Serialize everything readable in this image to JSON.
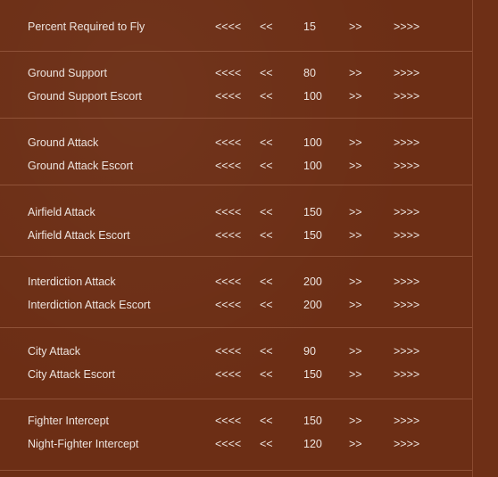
{
  "controls": {
    "dec_large": "<<<<",
    "dec_small": "<<",
    "inc_small": ">>",
    "inc_large": ">>>>"
  },
  "rows": [
    {
      "label": "Percent Required to Fly",
      "value": "15"
    },
    {
      "label": "Ground Support",
      "value": "80"
    },
    {
      "label": "Ground Support Escort",
      "value": "100"
    },
    {
      "label": "Ground Attack",
      "value": "100"
    },
    {
      "label": "Ground Attack Escort",
      "value": "100"
    },
    {
      "label": "Airfield Attack",
      "value": "150"
    },
    {
      "label": "Airfield Attack Escort",
      "value": "150"
    },
    {
      "label": "Interdiction Attack",
      "value": "200"
    },
    {
      "label": "Interdiction Attack Escort",
      "value": "200"
    },
    {
      "label": "City Attack",
      "value": "90"
    },
    {
      "label": "City Attack Escort",
      "value": "150"
    },
    {
      "label": "Fighter Intercept",
      "value": "150"
    },
    {
      "label": "Night-Fighter Intercept",
      "value": "120"
    }
  ]
}
